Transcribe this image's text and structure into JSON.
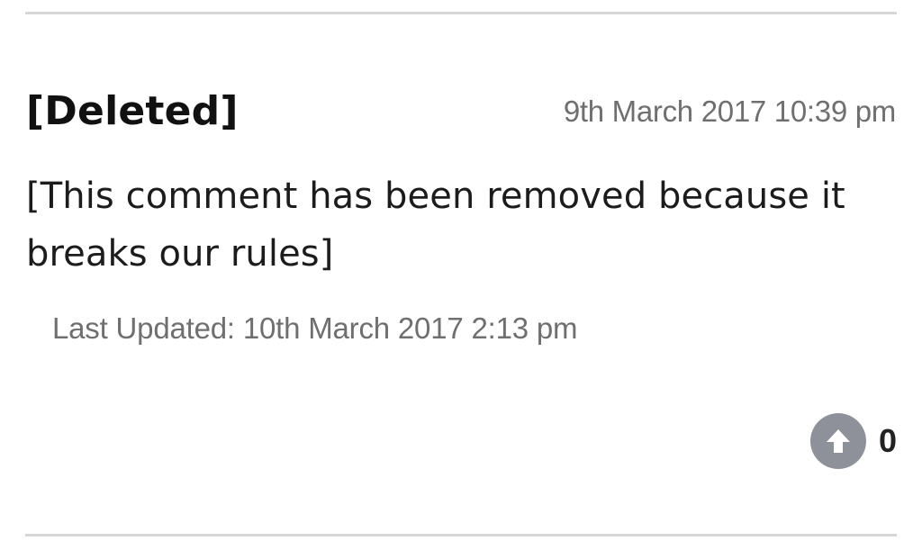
{
  "comment": {
    "author": "[Deleted]",
    "timestamp": "9th March 2017 10:39 pm",
    "body": "[This comment has been removed because it breaks our rules]",
    "last_updated": "Last Updated: 10th March 2017 2:13 pm",
    "vote_count": "0",
    "upvote_icon": "arrow-up-icon"
  },
  "colors": {
    "divider": "#d6d6d6",
    "muted_text": "#6f6f6f",
    "upvote_bg": "#8e9199"
  }
}
